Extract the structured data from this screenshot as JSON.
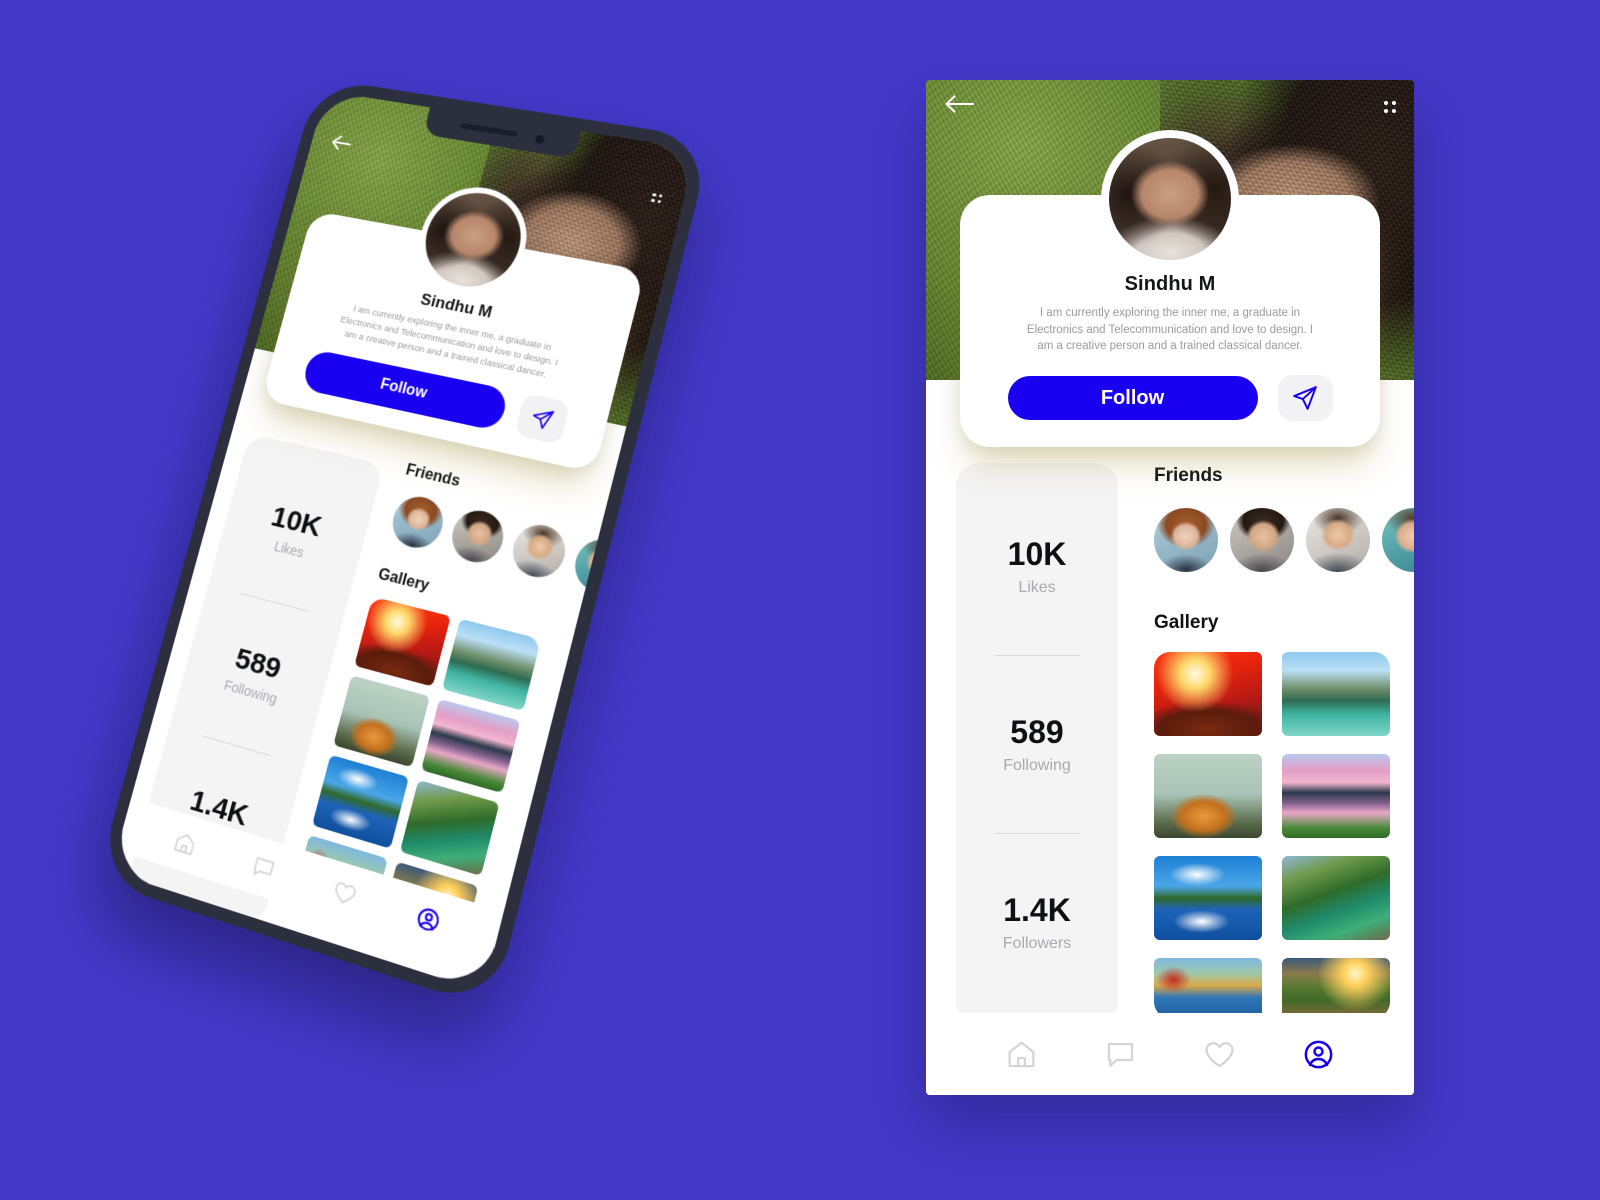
{
  "theme": {
    "background": "#4338C8",
    "accent_blue": "#1A00F0",
    "phone_frame": "#2B2F3E",
    "card_bg": "#FFFFFF",
    "stats_bg": "#F4F4F5",
    "muted_text": "#A9A9B0"
  },
  "header": {
    "back_icon": "back-arrow-icon",
    "menu_icon": "dots-grid-icon"
  },
  "profile": {
    "avatar_icon": "profile-avatar",
    "name": "Sindhu M",
    "bio": "I am currently exploring the inner me, a graduate in Electronics and Telecommunication and love to design. I am a creative person and a trained classical dancer.",
    "follow_label": "Follow",
    "send_icon": "paper-plane-icon"
  },
  "stats": [
    {
      "value": "10K",
      "label": "Likes"
    },
    {
      "value": "589",
      "label": "Following"
    },
    {
      "value": "1.4K",
      "label": "Followers"
    }
  ],
  "friends": {
    "title": "Friends",
    "avatars": [
      "friend-avatar-1",
      "friend-avatar-2",
      "friend-avatar-3",
      "friend-avatar-4"
    ]
  },
  "gallery": {
    "title": "Gallery",
    "items": [
      "autumn-red-forest-sunburst",
      "emerald-lake-mountain",
      "lone-orange-tree-misty-lake",
      "pink-sunset-lake-reflection",
      "blue-sky-clouds-lake-reflection",
      "green-valley-river-forest",
      "red-blossoms-autumn-lake",
      "golden-sunset-wooden-path"
    ]
  },
  "bottom_nav": {
    "items": [
      {
        "icon": "home-icon",
        "active": false
      },
      {
        "icon": "chat-icon",
        "active": false
      },
      {
        "icon": "heart-icon",
        "active": false
      },
      {
        "icon": "profile-icon",
        "active": true
      }
    ]
  }
}
